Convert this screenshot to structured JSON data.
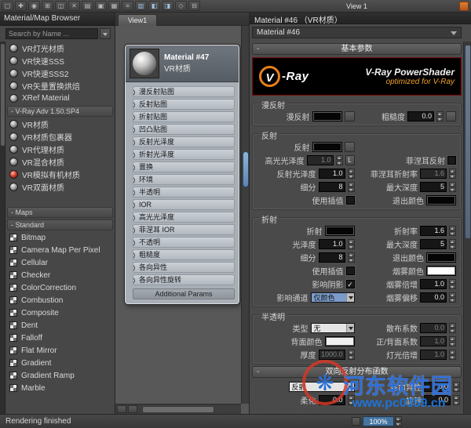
{
  "colors": {
    "accent_blue": "#6b96c4",
    "combo_highlight": "#7b9ccb",
    "vray_orange": "#e87f1c",
    "banner_subtitle_orange": "#f0a22c",
    "watermark_blue": "#2f6fd6",
    "watermark_red": "#d23828",
    "swatch_black": "#050505",
    "swatch_white": "#ffffff"
  },
  "toolbar": {
    "view_label": "View 1",
    "icons": [
      {
        "name": "select-tool-icon",
        "glyph": "▢"
      },
      {
        "name": "move-children-icon",
        "glyph": "✚"
      },
      {
        "name": "pick-material-icon",
        "glyph": "◉"
      },
      {
        "name": "put-to-scene-icon",
        "glyph": "⊞"
      },
      {
        "name": "assign-material-icon",
        "glyph": "◫"
      },
      {
        "name": "delete-selected-icon",
        "glyph": "✕"
      },
      {
        "name": "hide-unused-slots-icon",
        "glyph": "▤"
      },
      {
        "name": "show-shaded-material-icon",
        "glyph": "▣"
      },
      {
        "name": "show-background-icon",
        "glyph": "▦"
      },
      {
        "name": "layout-all-icon",
        "glyph": "≡"
      },
      {
        "name": "layout-children-icon",
        "glyph": "▥",
        "tint": "blue"
      },
      {
        "name": "material-browser-toggle-icon",
        "glyph": "◧",
        "tint": "blue"
      },
      {
        "name": "parameter-editor-toggle-icon",
        "glyph": "◨",
        "tint": "blue"
      },
      {
        "name": "select-by-material-icon",
        "glyph": "◇"
      },
      {
        "name": "options-icon",
        "glyph": "⊟"
      }
    ]
  },
  "browser": {
    "title": "Material/Map Browser",
    "search_placeholder": "Search by Name ...",
    "groups": [
      {
        "items": [
          {
            "label": "VR灯光材质",
            "icon": "sphere"
          },
          {
            "label": "VR快速SSS",
            "icon": "sphere"
          },
          {
            "label": "VR快速SSS2",
            "icon": "sphere"
          },
          {
            "label": "VR矢量置换烘焙",
            "icon": "sphere"
          },
          {
            "label": "XRef Material",
            "icon": "sphere"
          }
        ]
      },
      {
        "header": "- V-Ray Adv 1.50.SP4",
        "items": [
          {
            "label": "VR材质",
            "icon": "sphere"
          },
          {
            "label": "VR材质包裹器",
            "icon": "sphere"
          },
          {
            "label": "VR代理材质",
            "icon": "sphere"
          },
          {
            "label": "VR混合材质",
            "icon": "sphere"
          },
          {
            "label": "VR模拟有机材质",
            "icon": "sphere-red"
          },
          {
            "label": "VR双面材质",
            "icon": "sphere"
          }
        ]
      },
      {
        "header": "- Maps",
        "gap": true,
        "items": []
      },
      {
        "header": "- Standard",
        "items": [
          {
            "label": "Bitmap",
            "icon": "map"
          },
          {
            "label": "Camera Map Per Pixel",
            "icon": "map"
          },
          {
            "label": "Cellular",
            "icon": "map"
          },
          {
            "label": "Checker",
            "icon": "map"
          },
          {
            "label": "ColorCorrection",
            "icon": "map"
          },
          {
            "label": "Combustion",
            "icon": "map"
          },
          {
            "label": "Composite",
            "icon": "map"
          },
          {
            "label": "Dent",
            "icon": "map"
          },
          {
            "label": "Falloff",
            "icon": "map"
          },
          {
            "label": "Flat Mirror",
            "icon": "map"
          },
          {
            "label": "Gradient",
            "icon": "map"
          },
          {
            "label": "Gradient Ramp",
            "icon": "map"
          },
          {
            "label": "Marble",
            "icon": "map"
          }
        ]
      }
    ]
  },
  "node_editor": {
    "tab": "View1",
    "node": {
      "title": "Material #47",
      "subtitle": "VR材质",
      "slots": [
        "漫反射贴图",
        "反射贴图",
        "折射贴图",
        "凹凸贴图",
        "反射光泽度",
        "折射光泽度",
        "置换",
        "环境",
        "半透明",
        "IOR",
        "高光光泽度",
        "菲涅耳 IOR",
        "不透明",
        "粗糙度",
        "各向异性",
        "各向异性旋转"
      ],
      "footer": "Additional Params"
    }
  },
  "right_panel": {
    "title": "Material #46 （VR材质）",
    "selector": "Material #46",
    "collapse_glyph": "-",
    "rollout_basic": "基本参数",
    "rollout_brdf": "双向反射分布函数",
    "banner": {
      "logo_letter": "V",
      "logo_text": "-Ray",
      "title": "V-Ray PowerShader",
      "subtitle": "optimized for V-Ray"
    },
    "groups": [
      {
        "title": "漫反射",
        "rows": [
          {
            "left": {
              "type": "swatch",
              "label": "漫反射",
              "color": "#050505",
              "mapbtn": true
            },
            "right": {
              "type": "spin",
              "label": "粗糙度",
              "value": "0.0",
              "mapbtn": true
            }
          }
        ]
      },
      {
        "title": "反射",
        "rows": [
          {
            "left": {
              "type": "swatch",
              "label": "反射",
              "color": "#050505",
              "mapbtn": true
            },
            "right": null
          },
          {
            "left": {
              "type": "spin",
              "label": "高光光泽度",
              "value": "1.0",
              "disabled": true,
              "lock": "L"
            },
            "right": {
              "type": "check",
              "label": "菲涅耳反射",
              "checked": false
            }
          },
          {
            "left": {
              "type": "spin",
              "label": "反射光泽度",
              "value": "1.0"
            },
            "right": {
              "type": "spin",
              "label": "菲涅耳折射率",
              "value": "1.6",
              "disabled": true
            }
          },
          {
            "left": {
              "type": "spin",
              "label": "细分",
              "value": "8"
            },
            "right": {
              "type": "spin",
              "label": "最大深度",
              "value": "5"
            }
          },
          {
            "left": {
              "type": "check",
              "label": "使用插值",
              "checked": false
            },
            "right": {
              "type": "swatch",
              "label": "退出颜色",
              "color": "#050505"
            }
          }
        ]
      },
      {
        "title": "折射",
        "rows": [
          {
            "left": {
              "type": "swatch",
              "label": "折射",
              "color": "#050505"
            },
            "right": {
              "type": "spin",
              "label": "折射率",
              "value": "1.6"
            }
          },
          {
            "left": {
              "type": "spin",
              "label": "光泽度",
              "value": "1.0"
            },
            "right": {
              "type": "spin",
              "label": "最大深度",
              "value": "5"
            }
          },
          {
            "left": {
              "type": "spin",
              "label": "细分",
              "value": "8"
            },
            "right": {
              "type": "swatch",
              "label": "退出颜色",
              "color": "#050505"
            }
          },
          {
            "left": {
              "type": "check",
              "label": "使用插值",
              "checked": false
            },
            "right": {
              "type": "swatch",
              "label": "烟雾颜色",
              "color": "#ffffff"
            }
          },
          {
            "left": {
              "type": "check",
              "label": "影响阴影",
              "checked": true
            },
            "right": {
              "type": "spin",
              "label": "烟雾倍增",
              "value": "1.0"
            }
          },
          {
            "left": {
              "type": "combo",
              "label": "影响通道",
              "value": "仅颜色",
              "highlight": true
            },
            "right": {
              "type": "spin",
              "label": "烟雾偏移",
              "value": "0.0"
            }
          }
        ]
      },
      {
        "title": "半透明",
        "rows": [
          {
            "left": {
              "type": "combo",
              "label": "类型",
              "value": "无"
            },
            "right": {
              "type": "spin",
              "label": "散布系数",
              "value": "0.0",
              "disabled": true
            }
          },
          {
            "left": {
              "type": "swatch",
              "label": "背面颜色",
              "color": "#f0f0f0"
            },
            "right": {
              "type": "spin",
              "label": "正/背面系数",
              "value": "1.0",
              "disabled": true
            }
          },
          {
            "left": {
              "type": "spin",
              "label": "厚度",
              "value": "1000.0",
              "disabled": true
            },
            "right": {
              "type": "spin",
              "label": "灯光倍增",
              "value": "1.0",
              "disabled": true
            }
          }
        ]
      }
    ],
    "brdf_rows": [
      {
        "left": {
          "type": "combo",
          "value": "反射",
          "wide": true
        },
        "right": {
          "type": "spin",
          "label": "各向异性",
          "value": "0.0"
        }
      },
      {
        "left": {
          "type": "spin",
          "label": "柔化",
          "value": "0.0"
        },
        "right": {
          "type": "spin",
          "label": "旋转",
          "value": "0.0"
        }
      }
    ]
  },
  "statusbar": {
    "status": "Rendering finished",
    "zoom": "100%"
  },
  "watermark": {
    "logo_glyph": "❋",
    "name": "河东软件园",
    "url": "www.pc0359.cn"
  }
}
